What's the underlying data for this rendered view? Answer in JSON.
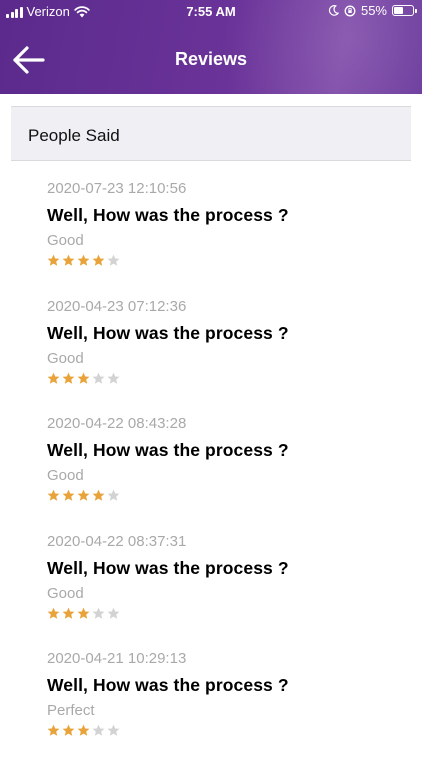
{
  "status_bar": {
    "carrier": "Verizon",
    "time": "7:55 AM",
    "battery_percent": "55%",
    "battery_level": 0.55,
    "icons": [
      "signal-icon",
      "wifi-icon",
      "moon-icon",
      "orientation-lock-icon",
      "battery-icon"
    ]
  },
  "nav": {
    "title": "Reviews",
    "back_icon": "arrow-left-icon"
  },
  "section": {
    "title": "People Said"
  },
  "colors": {
    "header": "#6a3399",
    "star_filled": "#e8a33a",
    "star_empty": "#d3d3d3",
    "muted_text": "#a9a9a9"
  },
  "reviews": [
    {
      "date": "2020-07-23 12:10:56",
      "question": "Well, How was the process ?",
      "comment": "Good",
      "rating": 4,
      "max": 5
    },
    {
      "date": "2020-04-23 07:12:36",
      "question": "Well, How was the process ?",
      "comment": "Good",
      "rating": 3,
      "max": 5
    },
    {
      "date": "2020-04-22 08:43:28",
      "question": "Well, How was the process ?",
      "comment": "Good",
      "rating": 4,
      "max": 5
    },
    {
      "date": "2020-04-22 08:37:31",
      "question": "Well, How was the process ?",
      "comment": "Good",
      "rating": 3,
      "max": 5
    },
    {
      "date": "2020-04-21 10:29:13",
      "question": "Well, How was the process ?",
      "comment": "Perfect",
      "rating": 3,
      "max": 5
    }
  ]
}
